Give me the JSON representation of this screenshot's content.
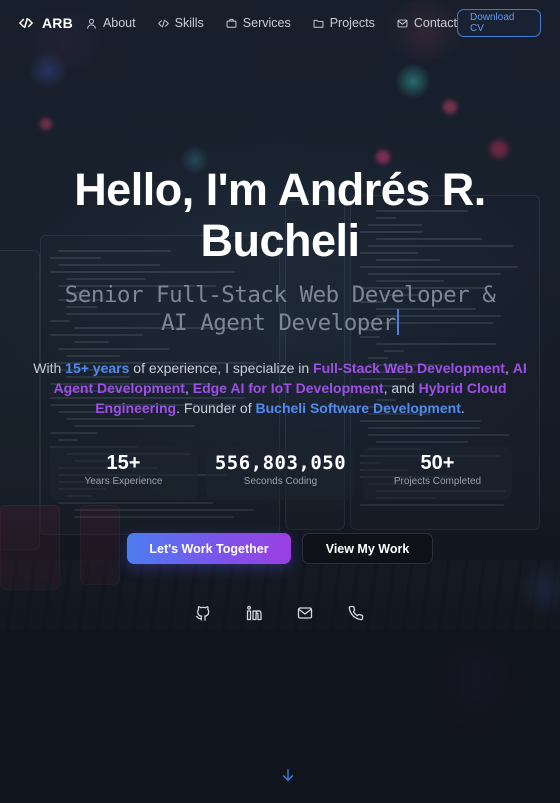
{
  "nav": {
    "brand_text": "ARB",
    "brand_icon": "code-icon",
    "items": [
      {
        "label": "About",
        "icon": "user-icon"
      },
      {
        "label": "Skills",
        "icon": "code-icon"
      },
      {
        "label": "Services",
        "icon": "briefcase-icon"
      },
      {
        "label": "Projects",
        "icon": "folder-icon"
      },
      {
        "label": "Contact",
        "icon": "mail-icon"
      }
    ],
    "cta_label": "Download CV"
  },
  "hero": {
    "title_line1": "Hello, I'm Andrés R.",
    "title_line2": "Bucheli",
    "subtitle_line1": "Senior Full-Stack Web Developer &",
    "subtitle_line2": "AI Agent Developer",
    "intro": {
      "t1": "With ",
      "h1": "15+ years",
      "t2": " of experience, I specialize in ",
      "h2": "Full-Stack Web Development",
      "t3": ", ",
      "h3": "AI Agent Development",
      "t4": ", ",
      "h4": "Edge AI for IoT Development",
      "t5": ", and ",
      "h5": "Hybrid Cloud Engineering",
      "t6": ". Founder of ",
      "h6": "Bucheli Software Development",
      "t7": "."
    }
  },
  "stats": [
    {
      "value": "15+",
      "label": "Years Experience"
    },
    {
      "value": "556,803,050",
      "label": "Seconds Coding"
    },
    {
      "value": "50+",
      "label": "Projects Completed"
    }
  ],
  "cta": {
    "primary": "Let's Work Together",
    "secondary": "View My Work"
  },
  "social": [
    "github-icon",
    "linkedin-icon",
    "mail-icon",
    "phone-icon"
  ],
  "scroll_icon": "arrow-down-icon",
  "colors": {
    "accent_blue": "#4f8cf0",
    "accent_purple": "#9d4fe6",
    "background": "#10151f"
  }
}
